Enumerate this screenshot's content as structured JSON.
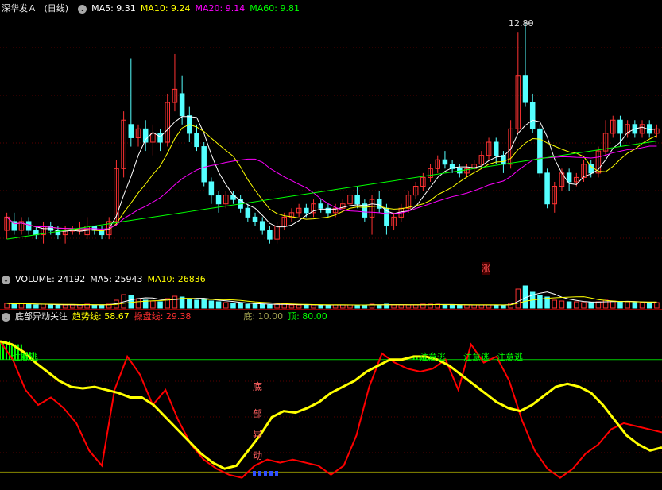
{
  "main_header": {
    "stock": "深华发Ａ",
    "period": "(日线)",
    "ma5": "MA5: 9.31",
    "ma10": "MA10: 9.24",
    "ma20": "MA20: 9.14",
    "ma60": "MA60: 9.81"
  },
  "peak_label": "12.80",
  "zhang_badge": "涨",
  "vol_header": {
    "vol": "VOLUME: 24192",
    "ma5": "MA5: 25943",
    "ma10": "MA10: 26836"
  },
  "ind_header": {
    "name": "底部异动关注",
    "trend": "趋势线: 58.67",
    "control": "操盘线: 29.38",
    "bottom": "底: 10.00",
    "top": "顶: 80.00"
  },
  "signal_labels": [
    "注意逃",
    "注意逃",
    "注意逃",
    "注意逃"
  ],
  "bottom_signal": [
    "底",
    "部",
    "异",
    "动"
  ],
  "colors": {
    "up": "#ff3232",
    "down": "#54ffff",
    "ma5": "#ffffff",
    "ma10": "#ffff00",
    "ma20": "#ff00ff",
    "ma60": "#00ff00",
    "trend": "#ffff00",
    "control": "#ff0000"
  },
  "chart_data": {
    "type": "candlestick",
    "price_ylim": [
      7.2,
      13.0
    ],
    "peak": 12.8,
    "candles": [
      [
        8.1,
        8.4,
        8.5,
        7.9
      ],
      [
        8.3,
        8.1,
        8.5,
        8.0
      ],
      [
        8.1,
        8.3,
        8.4,
        8.0
      ],
      [
        8.3,
        8.1,
        8.4,
        8.0
      ],
      [
        8.1,
        8.0,
        8.2,
        7.9
      ],
      [
        8.0,
        8.2,
        8.3,
        7.8
      ],
      [
        8.2,
        8.1,
        8.3,
        8.0
      ],
      [
        8.1,
        8.0,
        8.2,
        7.9
      ],
      [
        8.0,
        8.1,
        8.2,
        7.8
      ],
      [
        8.1,
        8.1,
        8.2,
        8.0
      ],
      [
        8.1,
        8.1,
        8.3,
        8.0
      ],
      [
        8.0,
        8.2,
        8.4,
        7.9
      ],
      [
        8.2,
        8.1,
        8.2,
        8.0
      ],
      [
        8.1,
        8.0,
        8.2,
        7.9
      ],
      [
        8.0,
        8.3,
        8.4,
        7.9
      ],
      [
        8.3,
        9.5,
        9.7,
        8.2
      ],
      [
        9.5,
        10.6,
        10.8,
        9.3
      ],
      [
        10.5,
        10.2,
        12.0,
        10.0
      ],
      [
        10.2,
        10.4,
        10.5,
        10.0
      ],
      [
        10.4,
        10.1,
        10.6,
        9.9
      ],
      [
        10.1,
        10.3,
        10.5,
        9.8
      ],
      [
        10.3,
        10.1,
        10.4,
        9.9
      ],
      [
        10.1,
        11.0,
        11.2,
        10.0
      ],
      [
        11.0,
        11.3,
        12.1,
        10.8
      ],
      [
        11.2,
        10.7,
        11.6,
        10.5
      ],
      [
        10.7,
        10.3,
        10.9,
        10.1
      ],
      [
        10.3,
        10.0,
        10.5,
        9.9
      ],
      [
        10.0,
        9.2,
        10.1,
        9.1
      ],
      [
        9.2,
        8.9,
        9.3,
        8.7
      ],
      [
        8.9,
        8.7,
        9.0,
        8.5
      ],
      [
        8.7,
        8.9,
        9.0,
        8.6
      ],
      [
        8.9,
        8.8,
        9.0,
        8.7
      ],
      [
        8.8,
        8.6,
        8.9,
        8.5
      ],
      [
        8.6,
        8.4,
        8.7,
        8.3
      ],
      [
        8.4,
        8.3,
        8.5,
        8.2
      ],
      [
        8.3,
        8.1,
        8.4,
        8.0
      ],
      [
        8.1,
        7.9,
        8.2,
        7.8
      ],
      [
        7.9,
        8.2,
        8.3,
        7.8
      ],
      [
        8.2,
        8.4,
        8.5,
        8.1
      ],
      [
        8.4,
        8.5,
        8.6,
        8.3
      ],
      [
        8.5,
        8.6,
        8.7,
        8.4
      ],
      [
        8.6,
        8.5,
        8.7,
        8.4
      ],
      [
        8.5,
        8.7,
        8.8,
        8.4
      ],
      [
        8.7,
        8.6,
        8.8,
        8.5
      ],
      [
        8.6,
        8.5,
        8.7,
        8.4
      ],
      [
        8.5,
        8.6,
        8.7,
        8.4
      ],
      [
        8.6,
        8.7,
        8.8,
        8.5
      ],
      [
        8.7,
        8.9,
        9.0,
        8.6
      ],
      [
        8.9,
        8.7,
        9.1,
        8.6
      ],
      [
        8.7,
        8.4,
        8.8,
        8.3
      ],
      [
        8.4,
        8.8,
        8.9,
        8.0
      ],
      [
        8.8,
        8.6,
        9.0,
        8.5
      ],
      [
        8.6,
        8.2,
        8.7,
        8.0
      ],
      [
        8.2,
        8.4,
        8.5,
        8.1
      ],
      [
        8.4,
        8.6,
        8.7,
        8.3
      ],
      [
        8.6,
        8.9,
        9.0,
        8.5
      ],
      [
        8.9,
        9.1,
        9.2,
        8.8
      ],
      [
        9.1,
        9.3,
        9.4,
        9.0
      ],
      [
        9.3,
        9.5,
        9.6,
        9.2
      ],
      [
        9.5,
        9.7,
        9.8,
        9.4
      ],
      [
        9.7,
        9.6,
        9.9,
        9.5
      ],
      [
        9.6,
        9.5,
        9.7,
        9.4
      ],
      [
        9.5,
        9.4,
        9.6,
        9.3
      ],
      [
        9.4,
        9.5,
        9.6,
        9.3
      ],
      [
        9.5,
        9.6,
        9.7,
        9.4
      ],
      [
        9.6,
        9.8,
        9.9,
        9.5
      ],
      [
        9.8,
        10.1,
        10.2,
        9.7
      ],
      [
        10.1,
        9.8,
        10.2,
        9.6
      ],
      [
        9.8,
        9.6,
        9.9,
        9.4
      ],
      [
        9.6,
        10.4,
        10.6,
        9.5
      ],
      [
        10.4,
        11.6,
        12.6,
        10.3
      ],
      [
        11.6,
        11.0,
        12.8,
        10.9
      ],
      [
        11.0,
        10.4,
        11.2,
        10.3
      ],
      [
        10.4,
        9.4,
        10.5,
        9.3
      ],
      [
        9.4,
        8.7,
        9.5,
        8.6
      ],
      [
        8.7,
        9.1,
        9.2,
        8.5
      ],
      [
        9.1,
        9.4,
        9.5,
        9.0
      ],
      [
        9.4,
        9.2,
        9.5,
        9.0
      ],
      [
        9.2,
        9.3,
        9.4,
        9.1
      ],
      [
        9.3,
        9.6,
        9.7,
        9.2
      ],
      [
        9.6,
        9.4,
        9.7,
        9.3
      ],
      [
        9.4,
        9.9,
        10.0,
        9.3
      ],
      [
        9.9,
        10.3,
        10.6,
        9.8
      ],
      [
        10.3,
        10.6,
        10.7,
        10.2
      ],
      [
        10.6,
        10.3,
        10.7,
        10.0
      ],
      [
        10.3,
        10.5,
        10.6,
        10.2
      ],
      [
        10.5,
        10.3,
        10.6,
        10.2
      ],
      [
        10.3,
        10.5,
        10.6,
        10.2
      ],
      [
        10.5,
        10.3,
        10.6,
        10.2
      ],
      [
        10.3,
        10.4,
        10.5,
        10.2
      ]
    ],
    "volume": [
      6,
      5,
      6,
      5,
      4,
      5,
      4,
      4,
      4,
      4,
      4,
      5,
      4,
      4,
      5,
      10,
      17,
      16,
      12,
      10,
      9,
      8,
      12,
      15,
      14,
      11,
      10,
      12,
      9,
      8,
      7,
      6,
      6,
      5,
      5,
      5,
      4,
      5,
      5,
      4,
      4,
      4,
      4,
      4,
      4,
      4,
      4,
      4,
      4,
      4,
      5,
      4,
      5,
      4,
      4,
      4,
      4,
      5,
      5,
      5,
      4,
      4,
      4,
      4,
      4,
      4,
      4,
      4,
      4,
      6,
      24,
      28,
      20,
      16,
      14,
      10,
      9,
      8,
      8,
      7,
      7,
      8,
      10,
      9,
      8,
      8,
      7,
      7,
      7,
      7
    ],
    "trend_line": [
      92,
      90,
      85,
      78,
      72,
      66,
      62,
      61,
      62,
      60,
      58,
      55,
      55,
      50,
      42,
      34,
      26,
      18,
      12,
      8,
      10,
      20,
      30,
      42,
      46,
      45,
      48,
      52,
      58,
      62,
      66,
      72,
      76,
      80,
      80,
      82,
      82,
      80,
      76,
      70,
      64,
      58,
      52,
      48,
      46,
      50,
      56,
      62,
      64,
      62,
      58,
      50,
      40,
      30,
      24,
      20,
      22
    ],
    "control_line": [
      92,
      80,
      60,
      50,
      55,
      48,
      38,
      20,
      10,
      60,
      82,
      70,
      50,
      60,
      40,
      24,
      14,
      8,
      4,
      2,
      10,
      14,
      12,
      14,
      12,
      10,
      4,
      10,
      30,
      62,
      84,
      78,
      74,
      72,
      74,
      80,
      60,
      90,
      78,
      82,
      66,
      40,
      20,
      8,
      2,
      8,
      18,
      24,
      34,
      38,
      36,
      34,
      32
    ],
    "bottom_level": 10.0,
    "top_level": 80.0,
    "trend_value": 58.67,
    "control_value": 29.38
  }
}
